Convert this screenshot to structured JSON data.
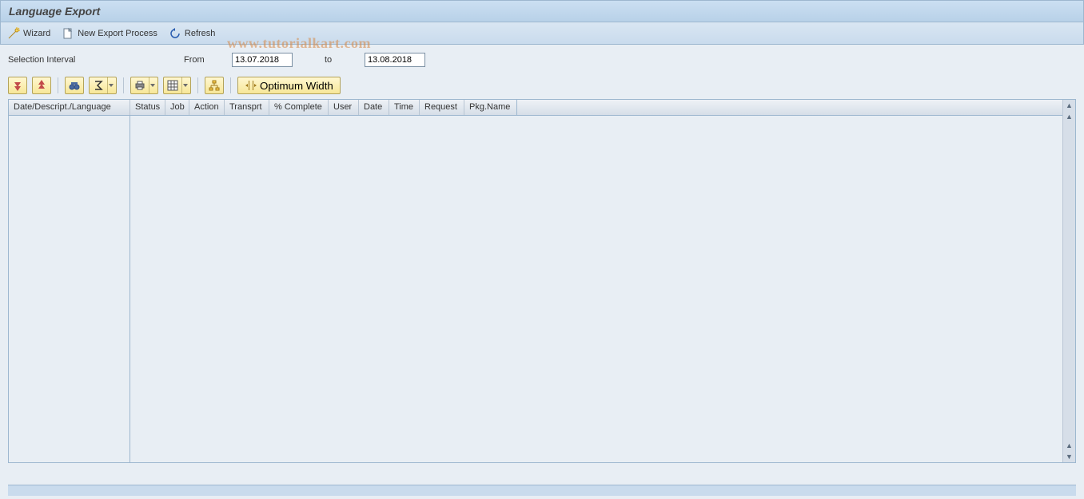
{
  "title": "Language Export",
  "appToolbar": {
    "wizard": "Wizard",
    "newExport": "New Export Process",
    "refresh": "Refresh"
  },
  "selection": {
    "label": "Selection Interval",
    "fromLabel": "From",
    "fromValue": "13.07.2018",
    "toLabel": "to",
    "toValue": "13.08.2018"
  },
  "alvToolbar": {
    "optimumWidth": "Optimum Width"
  },
  "columns": [
    "Date/Descript./Language",
    "Status",
    "Job",
    "Action",
    "Transprt",
    "% Complete",
    "User",
    "Date",
    "Time",
    "Request",
    "Pkg.Name"
  ],
  "watermark": "www.tutorialkart.com"
}
